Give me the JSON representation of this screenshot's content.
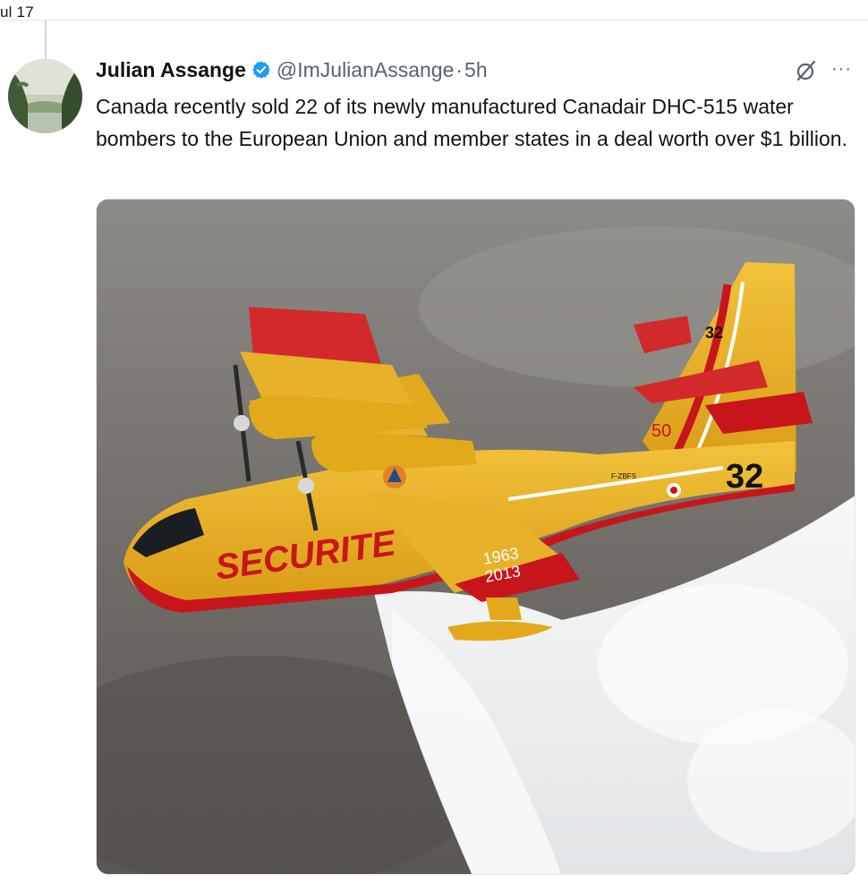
{
  "thread": {
    "date_fragment": "ul 17"
  },
  "tweet": {
    "author": {
      "display_name": "Julian Assange",
      "handle": "@ImJulianAssange",
      "verified": true,
      "verified_color": "#1d9bf0"
    },
    "separator": "·",
    "time": "5h",
    "text": "Canada recently sold 22 of its newly manufactured Canadair DHC-515 water bombers to the European Union and member states in a deal worth over $1 billion.",
    "icons": {
      "grok": "grok-icon",
      "more": "more-icon"
    },
    "more_glyph": "···",
    "media": {
      "aircraft_texts": {
        "fuselage": "SECURITE",
        "years_top": "1963",
        "years_bottom": "2013",
        "anniversary": "50",
        "tail_number_large": "32",
        "tail_number_small": "32",
        "registration": "F-ZBFS"
      }
    }
  }
}
